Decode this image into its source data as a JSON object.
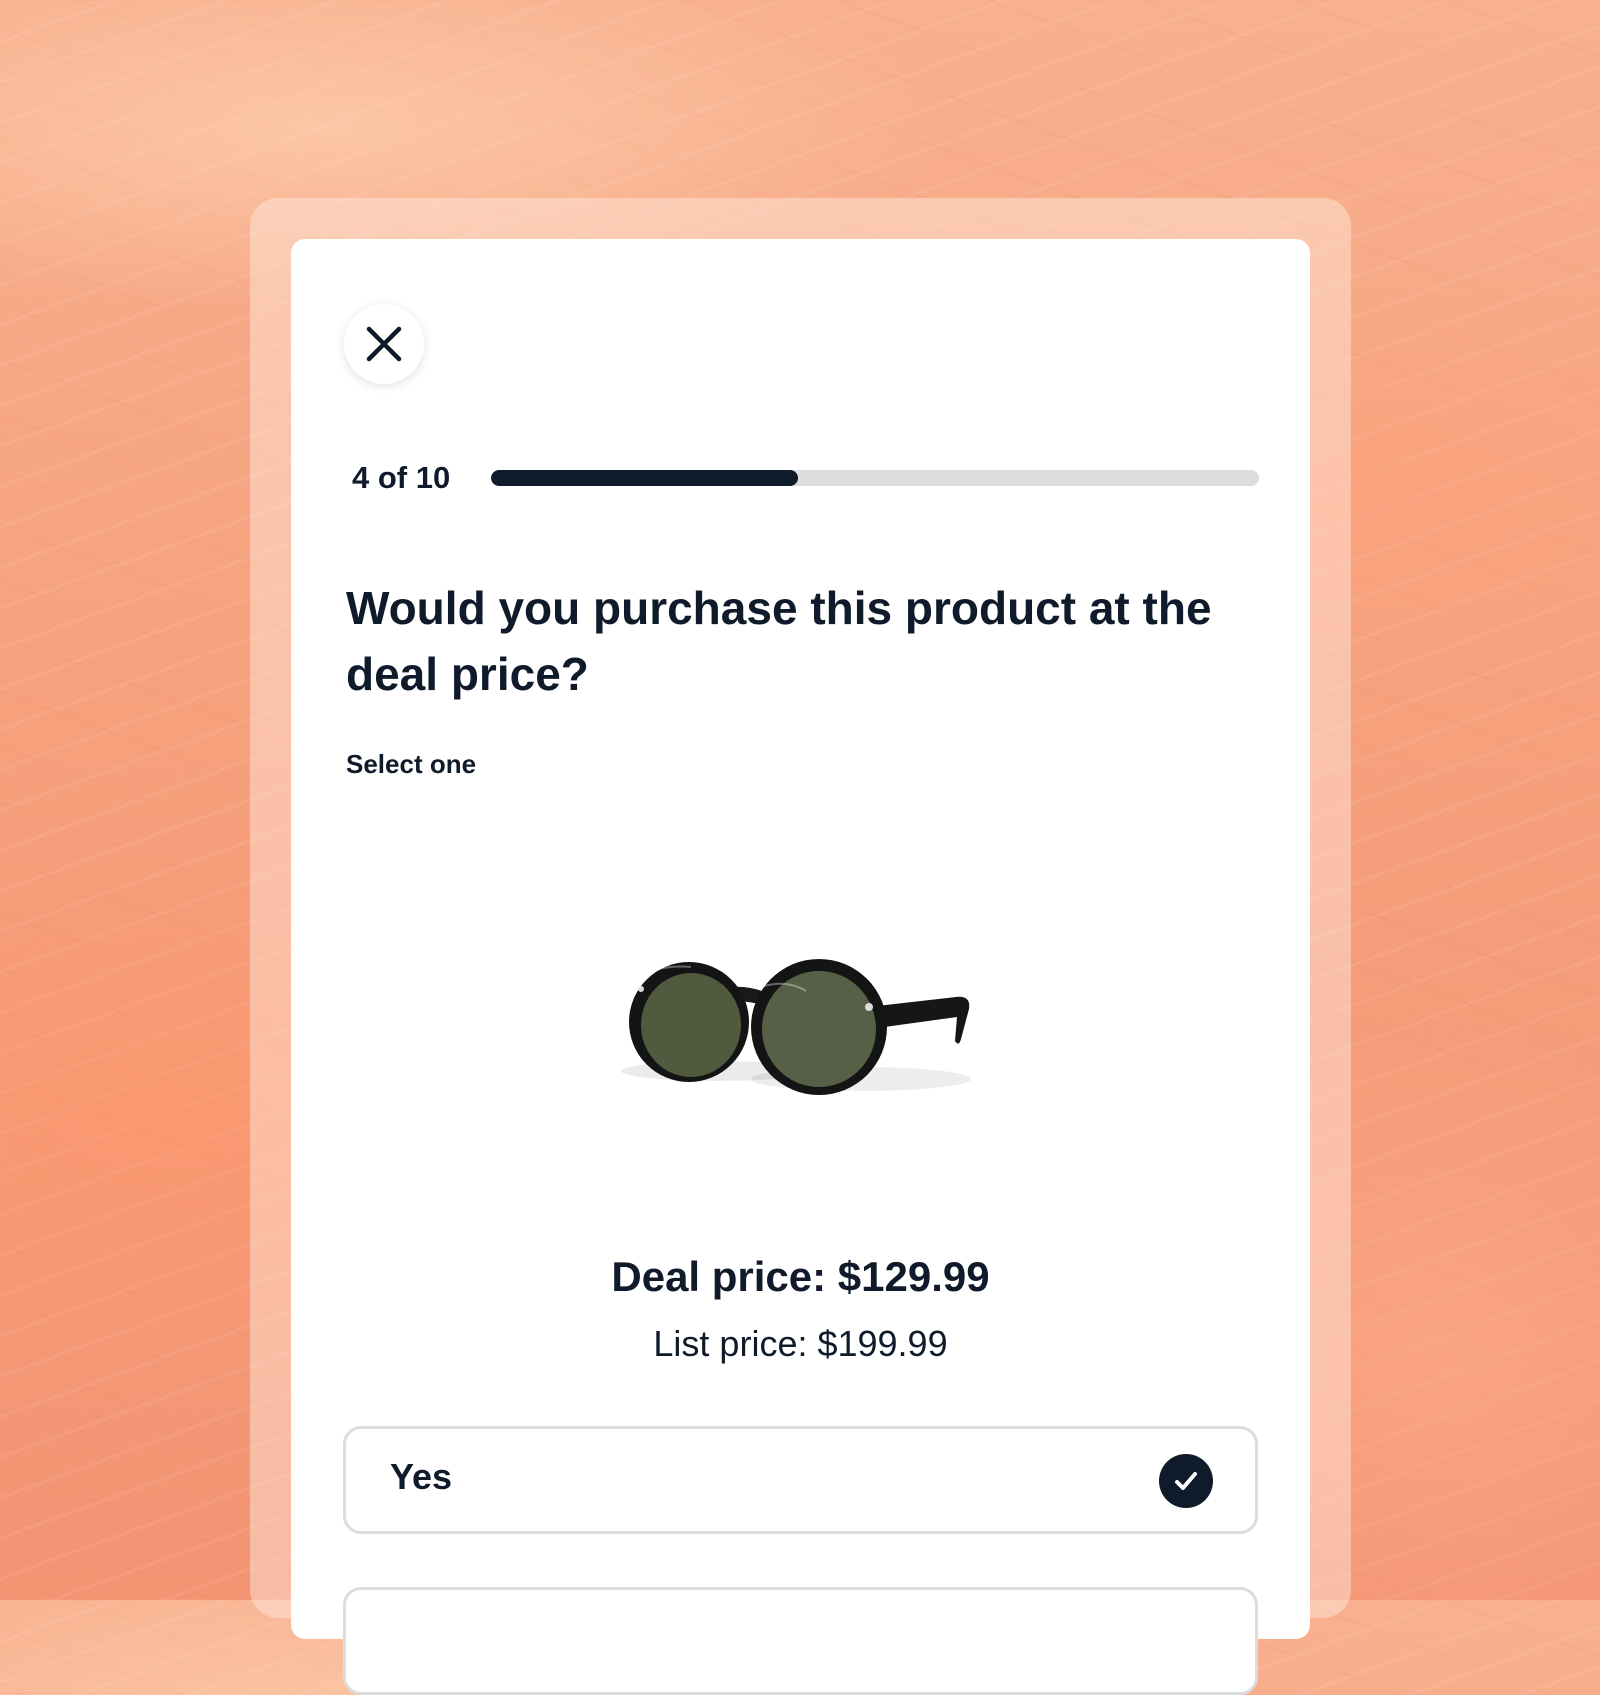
{
  "progress": {
    "label": "4 of 10",
    "current": 4,
    "total": 10,
    "fraction": 0.4
  },
  "question": {
    "title": "Would you purchase this product at the deal price?",
    "hint": "Select one"
  },
  "product": {
    "image_icon": "sunglasses-icon",
    "deal_price": "Deal price: $129.99",
    "list_price": "List price: $199.99"
  },
  "options": [
    {
      "label": "Yes",
      "selected": true
    },
    {
      "label": "",
      "selected": false
    }
  ],
  "colors": {
    "primary": "#0f1a2a",
    "track": "#dddddd",
    "border": "#dcdcdc",
    "background": "#f6a07c"
  },
  "icons": {
    "close": "close-icon",
    "check": "check-icon"
  }
}
